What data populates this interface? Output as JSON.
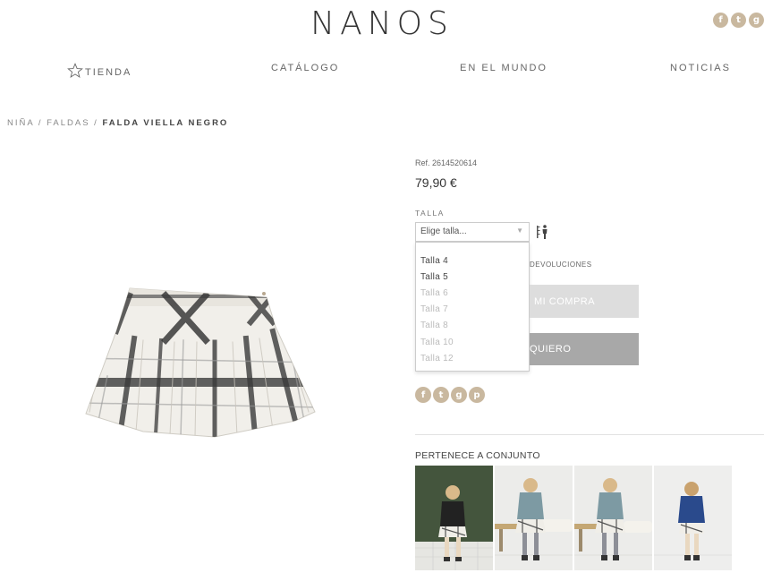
{
  "brand": {
    "logo": "NANOS"
  },
  "social_top": [
    "facebook-icon",
    "twitter-icon",
    "google-plus-icon"
  ],
  "nav": {
    "items": [
      {
        "label": "TIENDA",
        "icon": "star-icon"
      },
      {
        "label": "CATÁLOGO"
      },
      {
        "label": "EN EL MUNDO"
      },
      {
        "label": "NOTICIAS"
      }
    ]
  },
  "breadcrumb": {
    "items": [
      "NIÑA",
      "FALDAS"
    ],
    "separator": " / ",
    "current": "FALDA VIELLA NEGRO"
  },
  "product": {
    "ref": "Ref. 2614520614",
    "price": "79,90 €",
    "size_label": "TALLA",
    "size_select": {
      "placeholder": "Elige talla...",
      "options": [
        {
          "label": "Talla  4",
          "available": true
        },
        {
          "label": "Talla  5",
          "available": true
        },
        {
          "label": "Talla  6",
          "available": false
        },
        {
          "label": "Talla  7",
          "available": false
        },
        {
          "label": "Talla  8",
          "available": false
        },
        {
          "label": "Talla  10",
          "available": false
        },
        {
          "label": "Talla  12",
          "available": false
        }
      ]
    },
    "returns_text": "DEVOLUCIONES",
    "add_button": "MI COMPRA",
    "want_button": "QUIERO"
  },
  "social_share": [
    "facebook-icon",
    "twitter-icon",
    "google-plus-icon",
    "pinterest-icon"
  ],
  "set": {
    "title": "PERTENECE A CONJUNTO"
  },
  "colors": {
    "accent": "#c9b89f",
    "button_light": "#dddddd",
    "button_dark": "#a8a8a8"
  }
}
